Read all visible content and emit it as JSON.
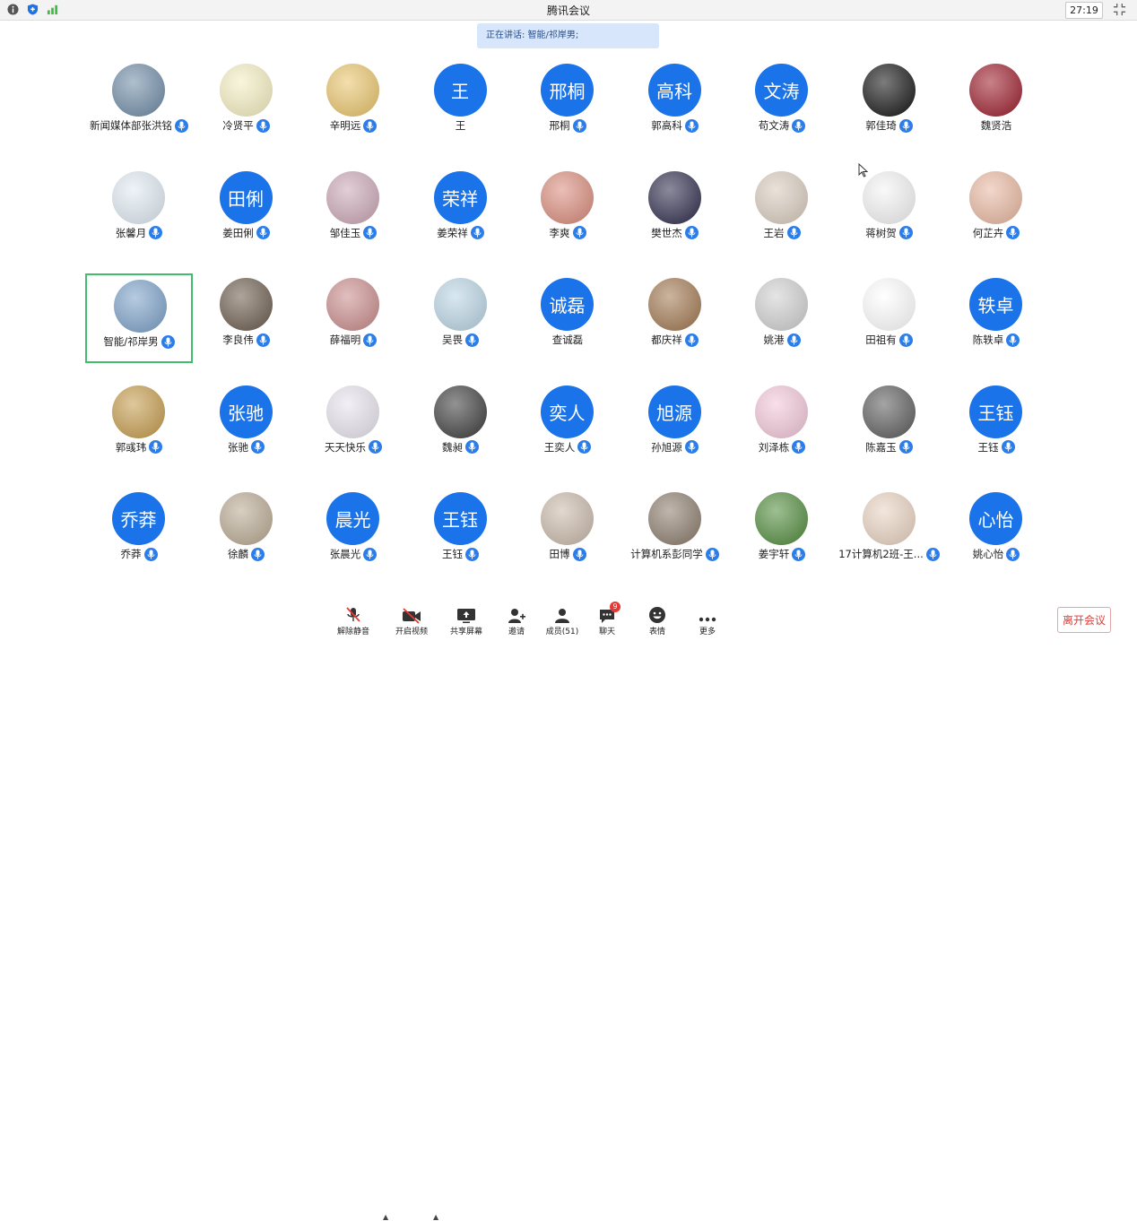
{
  "window": {
    "title": "腾讯会议",
    "timer": "27:19"
  },
  "speaking": {
    "label": "正在讲话: 智能/祁岸男;"
  },
  "participants": [
    {
      "name": "新闻媒体部张洪铭",
      "avatar_text": "",
      "avatar_color": "#6d8aa5",
      "mic": true
    },
    {
      "name": "冷贤平",
      "avatar_text": "",
      "avatar_color": "#f4eec0",
      "mic": true
    },
    {
      "name": "辛明远",
      "avatar_text": "",
      "avatar_color": "#e9c46a",
      "mic": true
    },
    {
      "name": "王",
      "avatar_text": "王",
      "avatar_color": "#1a73e8",
      "mic": false
    },
    {
      "name": "邢桐",
      "avatar_text": "邢桐",
      "avatar_color": "#1a73e8",
      "mic": true
    },
    {
      "name": "郭高科",
      "avatar_text": "高科",
      "avatar_color": "#1a73e8",
      "mic": true
    },
    {
      "name": "苟文涛",
      "avatar_text": "文涛",
      "avatar_color": "#1a73e8",
      "mic": true
    },
    {
      "name": "郭佳琦",
      "avatar_text": "",
      "avatar_color": "#111111",
      "mic": true
    },
    {
      "name": "魏贤浩",
      "avatar_text": "",
      "avatar_color": "#9b1b2a",
      "mic": false
    },
    {
      "name": "张馨月",
      "avatar_text": "",
      "avatar_color": "#dfe9f2",
      "mic": true
    },
    {
      "name": "姜田俐",
      "avatar_text": "田俐",
      "avatar_color": "#1a73e8",
      "mic": true
    },
    {
      "name": "邹佳玉",
      "avatar_text": "",
      "avatar_color": "#caa6b4",
      "mic": true
    },
    {
      "name": "姜荣祥",
      "avatar_text": "荣祥",
      "avatar_color": "#1a73e8",
      "mic": true
    },
    {
      "name": "李爽",
      "avatar_text": "",
      "avatar_color": "#d98a7a",
      "mic": true
    },
    {
      "name": "樊世杰",
      "avatar_text": "",
      "avatar_color": "#2c2a4a",
      "mic": true
    },
    {
      "name": "王岩",
      "avatar_text": "",
      "avatar_color": "#d8cbbd",
      "mic": true
    },
    {
      "name": "蒋树贺",
      "avatar_text": "",
      "avatar_color": "#f4f4f4",
      "mic": true
    },
    {
      "name": "何芷卉",
      "avatar_text": "",
      "avatar_color": "#e8b7a0",
      "mic": true
    },
    {
      "name": "智能/祁岸男",
      "avatar_text": "",
      "avatar_color": "#7aa0c8",
      "mic": true,
      "active": true
    },
    {
      "name": "李良伟",
      "avatar_text": "",
      "avatar_color": "#6a5a4a",
      "mic": true
    },
    {
      "name": "薛福明",
      "avatar_text": "",
      "avatar_color": "#c98a8a",
      "mic": true
    },
    {
      "name": "吴畏",
      "avatar_text": "",
      "avatar_color": "#b9d4e4",
      "mic": true
    },
    {
      "name": "查诚磊",
      "avatar_text": "诚磊",
      "avatar_color": "#1a73e8",
      "mic": false
    },
    {
      "name": "都庆祥",
      "avatar_text": "",
      "avatar_color": "#a0764e",
      "mic": true
    },
    {
      "name": "姚港",
      "avatar_text": "",
      "avatar_color": "#cfcfcf",
      "mic": true
    },
    {
      "name": "田祖有",
      "avatar_text": "",
      "avatar_color": "#ffffff",
      "mic": true
    },
    {
      "name": "陈轶卓",
      "avatar_text": "轶卓",
      "avatar_color": "#1a73e8",
      "mic": true
    },
    {
      "name": "郭彧玮",
      "avatar_text": "",
      "avatar_color": "#c49a4a",
      "mic": true
    },
    {
      "name": "张驰",
      "avatar_text": "张驰",
      "avatar_color": "#1a73e8",
      "mic": true
    },
    {
      "name": "天天快乐",
      "avatar_text": "",
      "avatar_color": "#e7e3ee",
      "mic": true
    },
    {
      "name": "魏昶",
      "avatar_text": "",
      "avatar_color": "#3a3a3a",
      "mic": true
    },
    {
      "name": "王奕人",
      "avatar_text": "奕人",
      "avatar_color": "#1a73e8",
      "mic": true
    },
    {
      "name": "孙旭源",
      "avatar_text": "旭源",
      "avatar_color": "#1a73e8",
      "mic": true
    },
    {
      "name": "刘泽栋",
      "avatar_text": "",
      "avatar_color": "#f2c6d8",
      "mic": true
    },
    {
      "name": "陈嘉玉",
      "avatar_text": "",
      "avatar_color": "#5a5a5a",
      "mic": true
    },
    {
      "name": "王钰",
      "avatar_text": "王钰",
      "avatar_color": "#1a73e8",
      "mic": true
    },
    {
      "name": "乔莽",
      "avatar_text": "乔莽",
      "avatar_color": "#1a73e8",
      "mic": true
    },
    {
      "name": "徐麟",
      "avatar_text": "",
      "avatar_color": "#b8a890",
      "mic": true
    },
    {
      "name": "张晨光",
      "avatar_text": "晨光",
      "avatar_color": "#1a73e8",
      "mic": true
    },
    {
      "name": "王钰",
      "avatar_text": "王钰",
      "avatar_color": "#1a73e8",
      "mic": true
    },
    {
      "name": "田博",
      "avatar_text": "",
      "avatar_color": "#c9b8a8",
      "mic": true
    },
    {
      "name": "计算机系彭同学",
      "avatar_text": "",
      "avatar_color": "#8a7a6a",
      "mic": true
    },
    {
      "name": "姜宇轩",
      "avatar_text": "",
      "avatar_color": "#4f8a3a",
      "mic": true
    },
    {
      "name": "17计算机2班-王...",
      "avatar_text": "",
      "avatar_color": "#e8d2c0",
      "mic": true
    },
    {
      "name": "姚心怡",
      "avatar_text": "心怡",
      "avatar_color": "#1a73e8",
      "mic": true
    }
  ],
  "toolbar": {
    "unmute": "解除静音",
    "video": "开启视频",
    "share": "共享屏幕",
    "invite": "邀请",
    "members": "成员(51)",
    "chat": "聊天",
    "chat_badge": "9",
    "reactions": "表情",
    "more": "更多"
  },
  "leave": {
    "label": "离开会议"
  }
}
